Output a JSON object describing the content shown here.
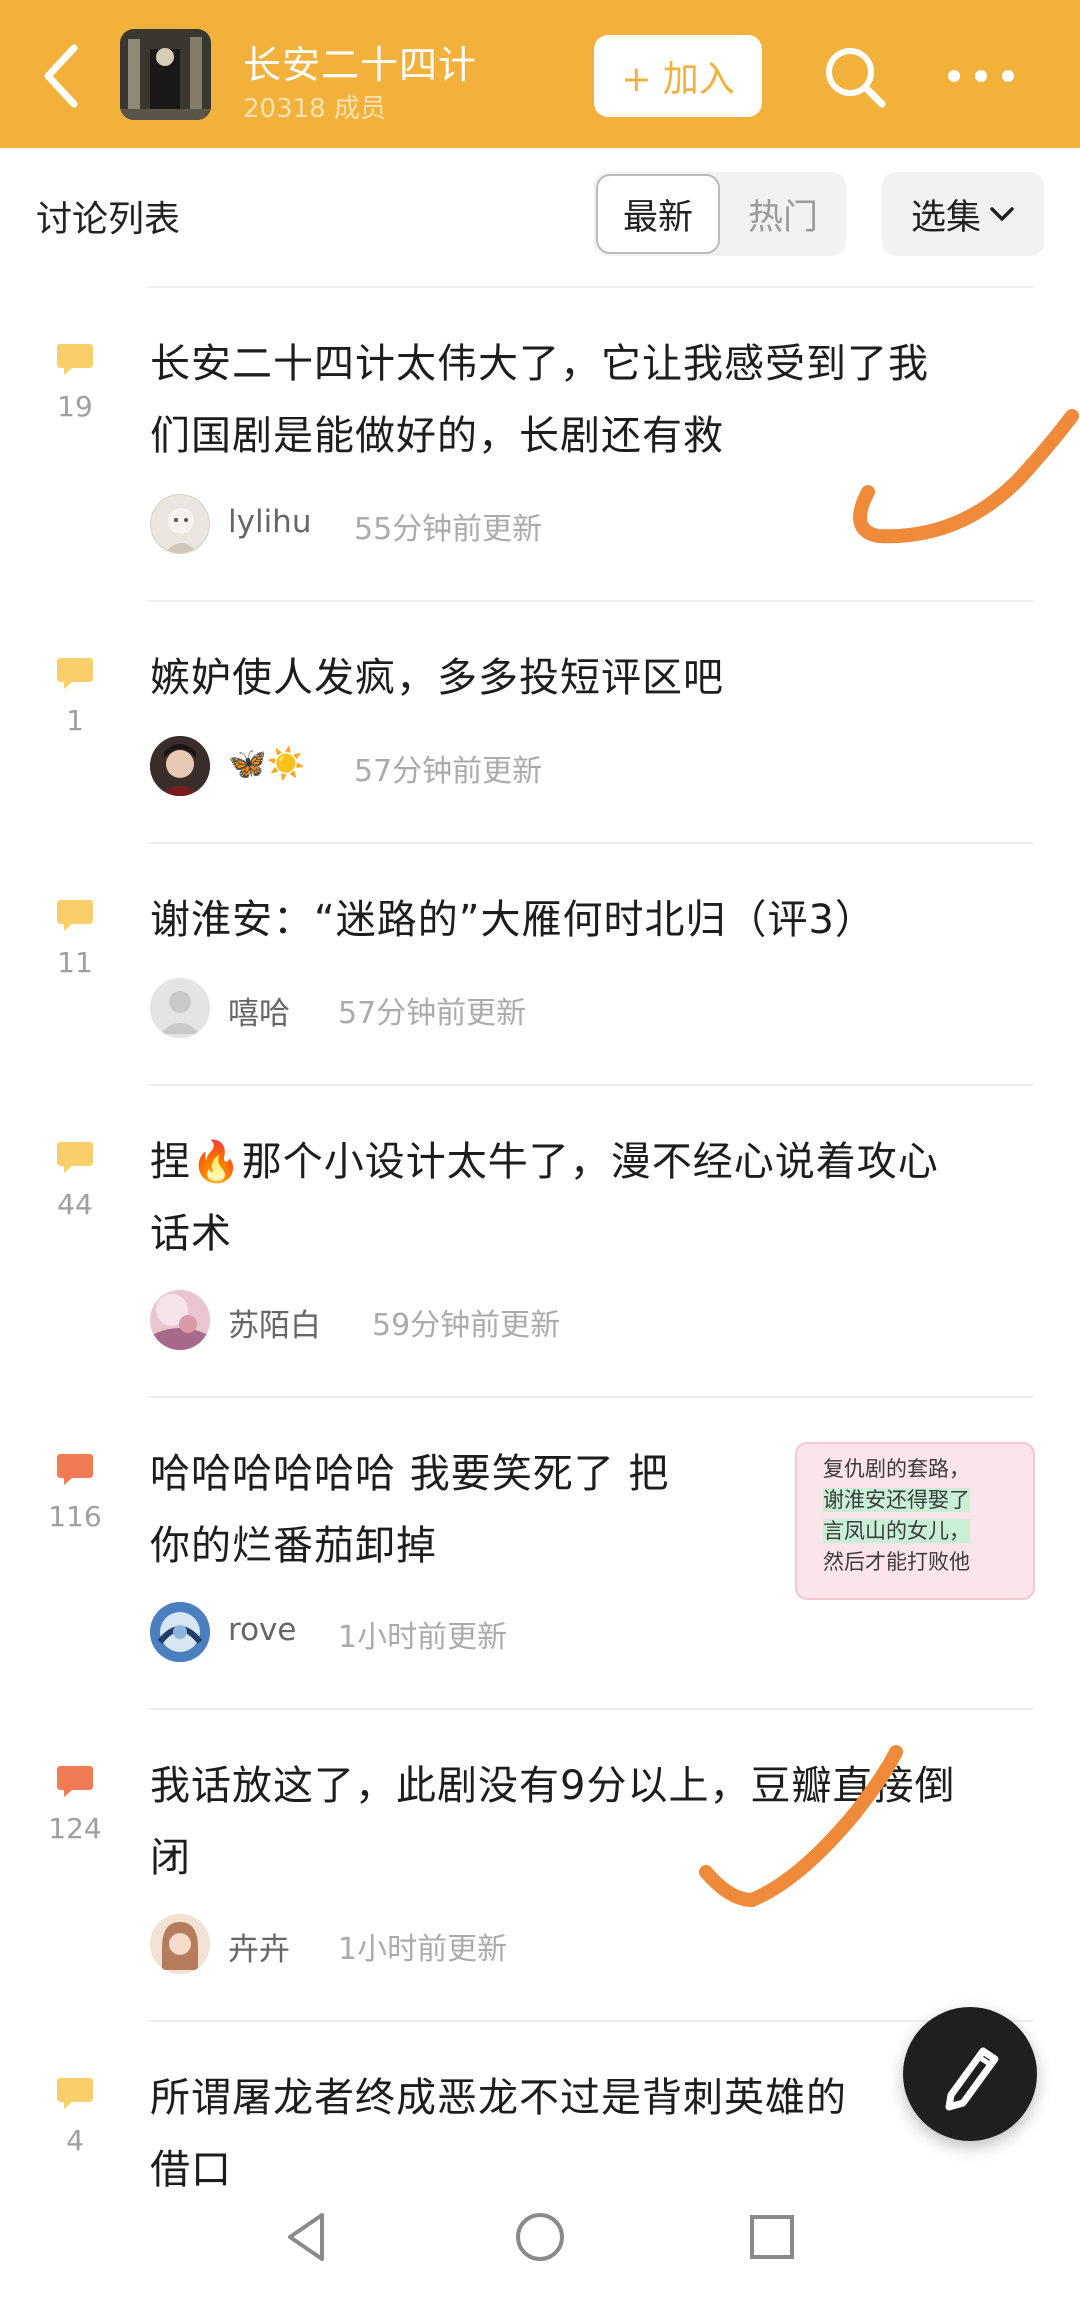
{
  "header": {
    "group_name": "长安二十四计",
    "member_count": "20318 成员",
    "join_label": "+ 加入",
    "icons": [
      "back-arrow-icon",
      "search-icon",
      "more-dots-icon"
    ],
    "accent_color": "#f2b13b"
  },
  "toolbar": {
    "list_title": "讨论列表",
    "tabs": [
      "最新",
      "热门"
    ],
    "active_tab": "最新",
    "episodes_label": "选集"
  },
  "posts": [
    {
      "title_line1": "长安二十四计太伟大了，它让我感受到了我",
      "title_line2": "们国剧是能做好的，长剧还有救",
      "count": "19",
      "author": "lylihu",
      "time": "55分钟前更新",
      "hot": false
    },
    {
      "title_line1": "嫉妒使人发疯，多多投短评区吧",
      "count": "1",
      "author": "🦋☀️",
      "time": "57分钟前更新",
      "hot": false
    },
    {
      "title_line1": "谢淮安：“迷路的”大雁何时北归（评3）",
      "count": "11",
      "author": "嘻哈",
      "time": "57分钟前更新",
      "hot": false
    },
    {
      "title_line1": "捏🔥那个小设计太牛了，漫不经心说着攻心",
      "title_line2": "话术",
      "count": "44",
      "author": "苏陌白",
      "time": "59分钟前更新",
      "hot": false
    },
    {
      "title_line1": "哈哈哈哈哈哈 我要笑死了 把",
      "title_line2": "你的烂番茄卸掉",
      "count": "116",
      "author": "rove",
      "time": "1小时前更新",
      "hot": true,
      "thumb_lines": [
        "复仇剧的套路，",
        "谢淮安还得娶了",
        "言凤山的女儿，",
        "然后才能打败他"
      ]
    },
    {
      "title_line1": "我话放这了，此剧没有9分以上，豆瓣直接倒",
      "title_line2": "闭",
      "count": "124",
      "author": "卉卉",
      "time": "1小时前更新",
      "hot": true
    },
    {
      "title_line1": "所谓屠龙者终成恶龙不过是背刺英雄的",
      "title_line2": "借口",
      "count": "4",
      "hot": false
    }
  ],
  "colors": {
    "bubble_normal": "#f8cf6a",
    "bubble_hot": "#f07b55",
    "annotation": "#ef8a3a"
  },
  "fab": {
    "icon": "pen-icon"
  },
  "navbar": {
    "icons": [
      "nav-back-icon",
      "nav-home-icon",
      "nav-recents-icon"
    ]
  }
}
